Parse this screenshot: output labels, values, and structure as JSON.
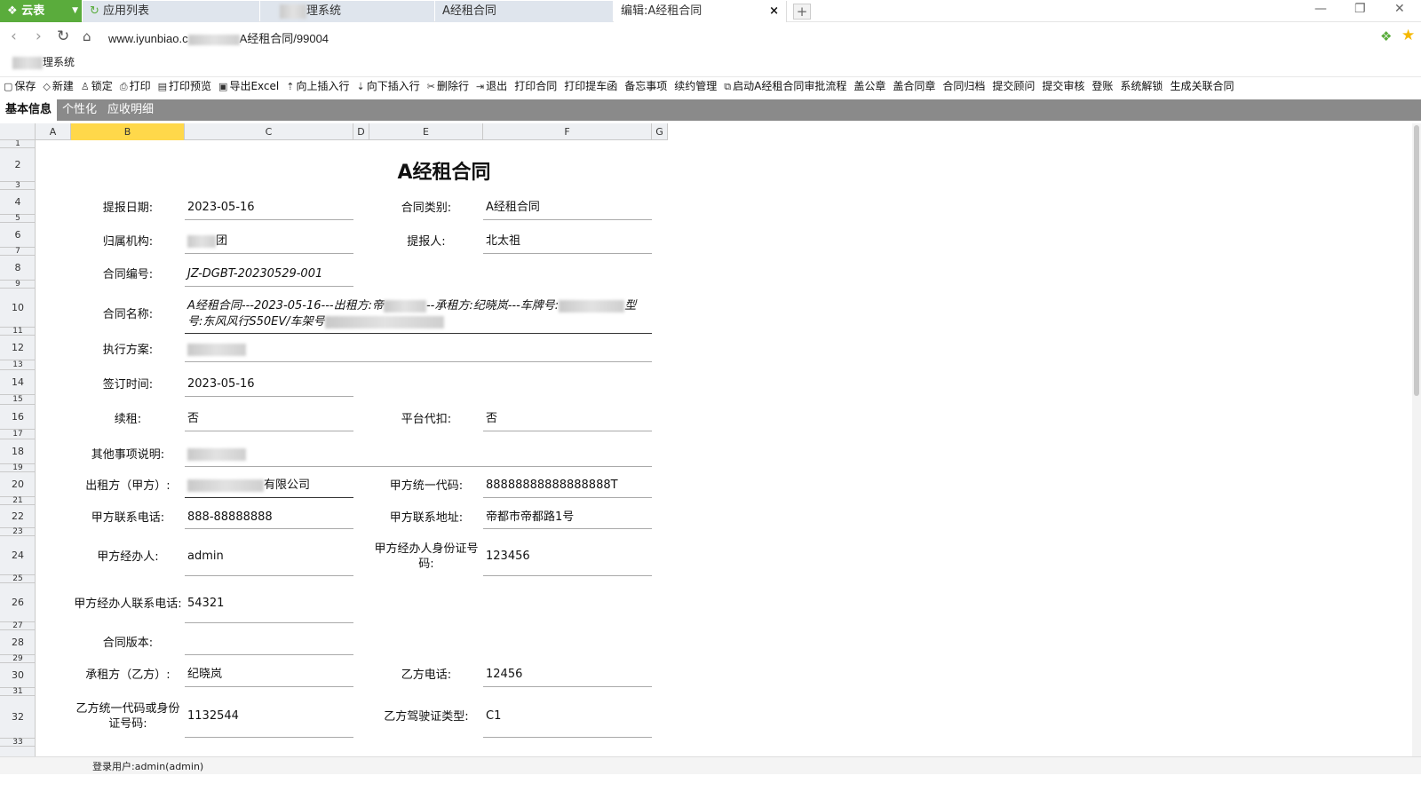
{
  "tabs": {
    "yunbiao": "云表",
    "applist": "应用列表",
    "system_suffix": "理系统",
    "contract": "A经租合同",
    "edit": "编辑:A经租合同",
    "close": "×",
    "add": "+"
  },
  "window_controls": {
    "minimize": "—",
    "restore": "❐",
    "close": "✕"
  },
  "address": {
    "url_prefix": "www.iyunbiao.c",
    "url_suffix": "A经租合同/99004"
  },
  "bookmark": {
    "suffix": "理系统"
  },
  "toolbar": [
    {
      "icon": "▢",
      "label": "保存"
    },
    {
      "icon": "◇",
      "label": "新建"
    },
    {
      "icon": "♙",
      "label": "锁定"
    },
    {
      "icon": "⎙",
      "label": "打印"
    },
    {
      "icon": "▤",
      "label": "打印预览"
    },
    {
      "icon": "▣",
      "label": "导出Excel"
    },
    {
      "icon": "⇡",
      "label": "向上插入行"
    },
    {
      "icon": "⇣",
      "label": "向下插入行"
    },
    {
      "icon": "✂",
      "label": "删除行"
    },
    {
      "icon": "⇥",
      "label": "退出"
    },
    {
      "icon": "",
      "label": "打印合同"
    },
    {
      "icon": "",
      "label": "打印提车函"
    },
    {
      "icon": "",
      "label": "备忘事项"
    },
    {
      "icon": "",
      "label": "续约管理"
    },
    {
      "icon": "⧉",
      "label": "启动A经租合同审批流程"
    },
    {
      "icon": "",
      "label": "盖公章"
    },
    {
      "icon": "",
      "label": "盖合同章"
    },
    {
      "icon": "",
      "label": "合同归档"
    },
    {
      "icon": "",
      "label": "提交顾问"
    },
    {
      "icon": "",
      "label": "提交审核"
    },
    {
      "icon": "",
      "label": "登账"
    },
    {
      "icon": "",
      "label": "系统解锁"
    },
    {
      "icon": "",
      "label": "生成关联合同"
    }
  ],
  "sheet_tabs": [
    "基本信息",
    "个性化",
    "应收明细"
  ],
  "columns": [
    "A",
    "B",
    "C",
    "D",
    "E",
    "F",
    "G"
  ],
  "rows": [
    "1",
    "2",
    "3",
    "4",
    "5",
    "6",
    "7",
    "8",
    "9",
    "10",
    "11",
    "12",
    "13",
    "14",
    "15",
    "16",
    "17",
    "18",
    "19",
    "20",
    "21",
    "22",
    "23",
    "24",
    "25",
    "26",
    "27",
    "28",
    "29",
    "30",
    "31",
    "32",
    "33"
  ],
  "form": {
    "title": "A经租合同",
    "report_date_label": "提报日期:",
    "report_date": "2023-05-16",
    "contract_type_label": "合同类别:",
    "contract_type": "A经租合同",
    "org_label": "归属机构:",
    "org_suffix": "团",
    "reporter_label": "提报人:",
    "reporter": "北太祖",
    "contract_no_label": "合同编号:",
    "contract_no": "JZ-DGBT-20230529-001",
    "contract_name_label": "合同名称:",
    "contract_name_l1a": "A经租合同---2023-05-16---出租方:帝",
    "contract_name_l1b": "--承租方:纪晓岚---车牌号:",
    "contract_name_l1c": "型",
    "contract_name_l2a": "号:东风风行S50EV/车架号",
    "plan_label": "执行方案:",
    "sign_time_label": "签订时间:",
    "sign_time": "2023-05-16",
    "renew_label": "续租:",
    "renew": "否",
    "platform_label": "平台代扣:",
    "platform": "否",
    "other_label": "其他事项说明:",
    "lessor_label": "出租方（甲方）:",
    "lessor_suffix": "有限公司",
    "a_code_label": "甲方统一代码:",
    "a_code": "88888888888888888T",
    "a_phone_label": "甲方联系电话:",
    "a_phone": "888-88888888",
    "a_addr_label": "甲方联系地址:",
    "a_addr": "帝都市帝都路1号",
    "a_agent_label": "甲方经办人:",
    "a_agent": "admin",
    "a_agent_id_label": "甲方经办人身份证号码:",
    "a_agent_id": "123456",
    "a_agent_phone_label": "甲方经办人联系电话:",
    "a_agent_phone": "54321",
    "version_label": "合同版本:",
    "version": "",
    "lessee_label": "承租方（乙方）:",
    "lessee": "纪晓岚",
    "b_phone_label": "乙方电话:",
    "b_phone": "12456",
    "b_code_label": "乙方统一代码或身份证号码:",
    "b_code": "1132544",
    "b_license_label": "乙方驾驶证类型:",
    "b_license": "C1"
  },
  "status": {
    "user": "登录用户:admin(admin)"
  }
}
